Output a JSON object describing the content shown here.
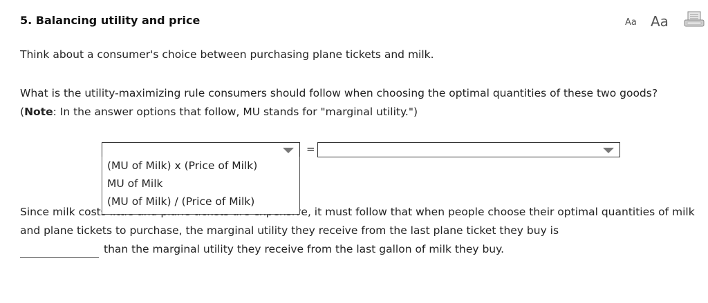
{
  "header": {
    "title": "5. Balancing utility and price",
    "font_small_label": "Aa",
    "font_large_label": "Aa",
    "print_icon": "printer-icon"
  },
  "body": {
    "intro": "Think about a consumer's choice between purchasing plane tickets and milk.",
    "question_part1": "What is the utility-maximizing rule consumers should follow when choosing the optimal quantities of these two goods? (",
    "question_note_bold": "Note",
    "question_part2": ": In the answer options that follow, MU stands for \"marginal utility.\")",
    "equals_sign": "=",
    "left_select": {
      "value": "",
      "options": [
        "(MU of Milk) x (Price of Milk)",
        "MU of Milk",
        "(MU of Milk) / (Price of Milk)"
      ]
    },
    "right_select": {
      "value": ""
    },
    "sentence_part1": "Since milk costs little and plane tickets are expensive, it must follow that when people choose their optimal quantities of milk and plane tickets to purchase, the marginal utility they receive from the last plane ticket they buy is",
    "blank_value": "",
    "sentence_part2": "than the marginal utility they receive from the last gallon of milk they buy."
  },
  "colors": {
    "text": "#222222",
    "border": "#333333",
    "caret": "#777777",
    "background": "#ffffff"
  }
}
